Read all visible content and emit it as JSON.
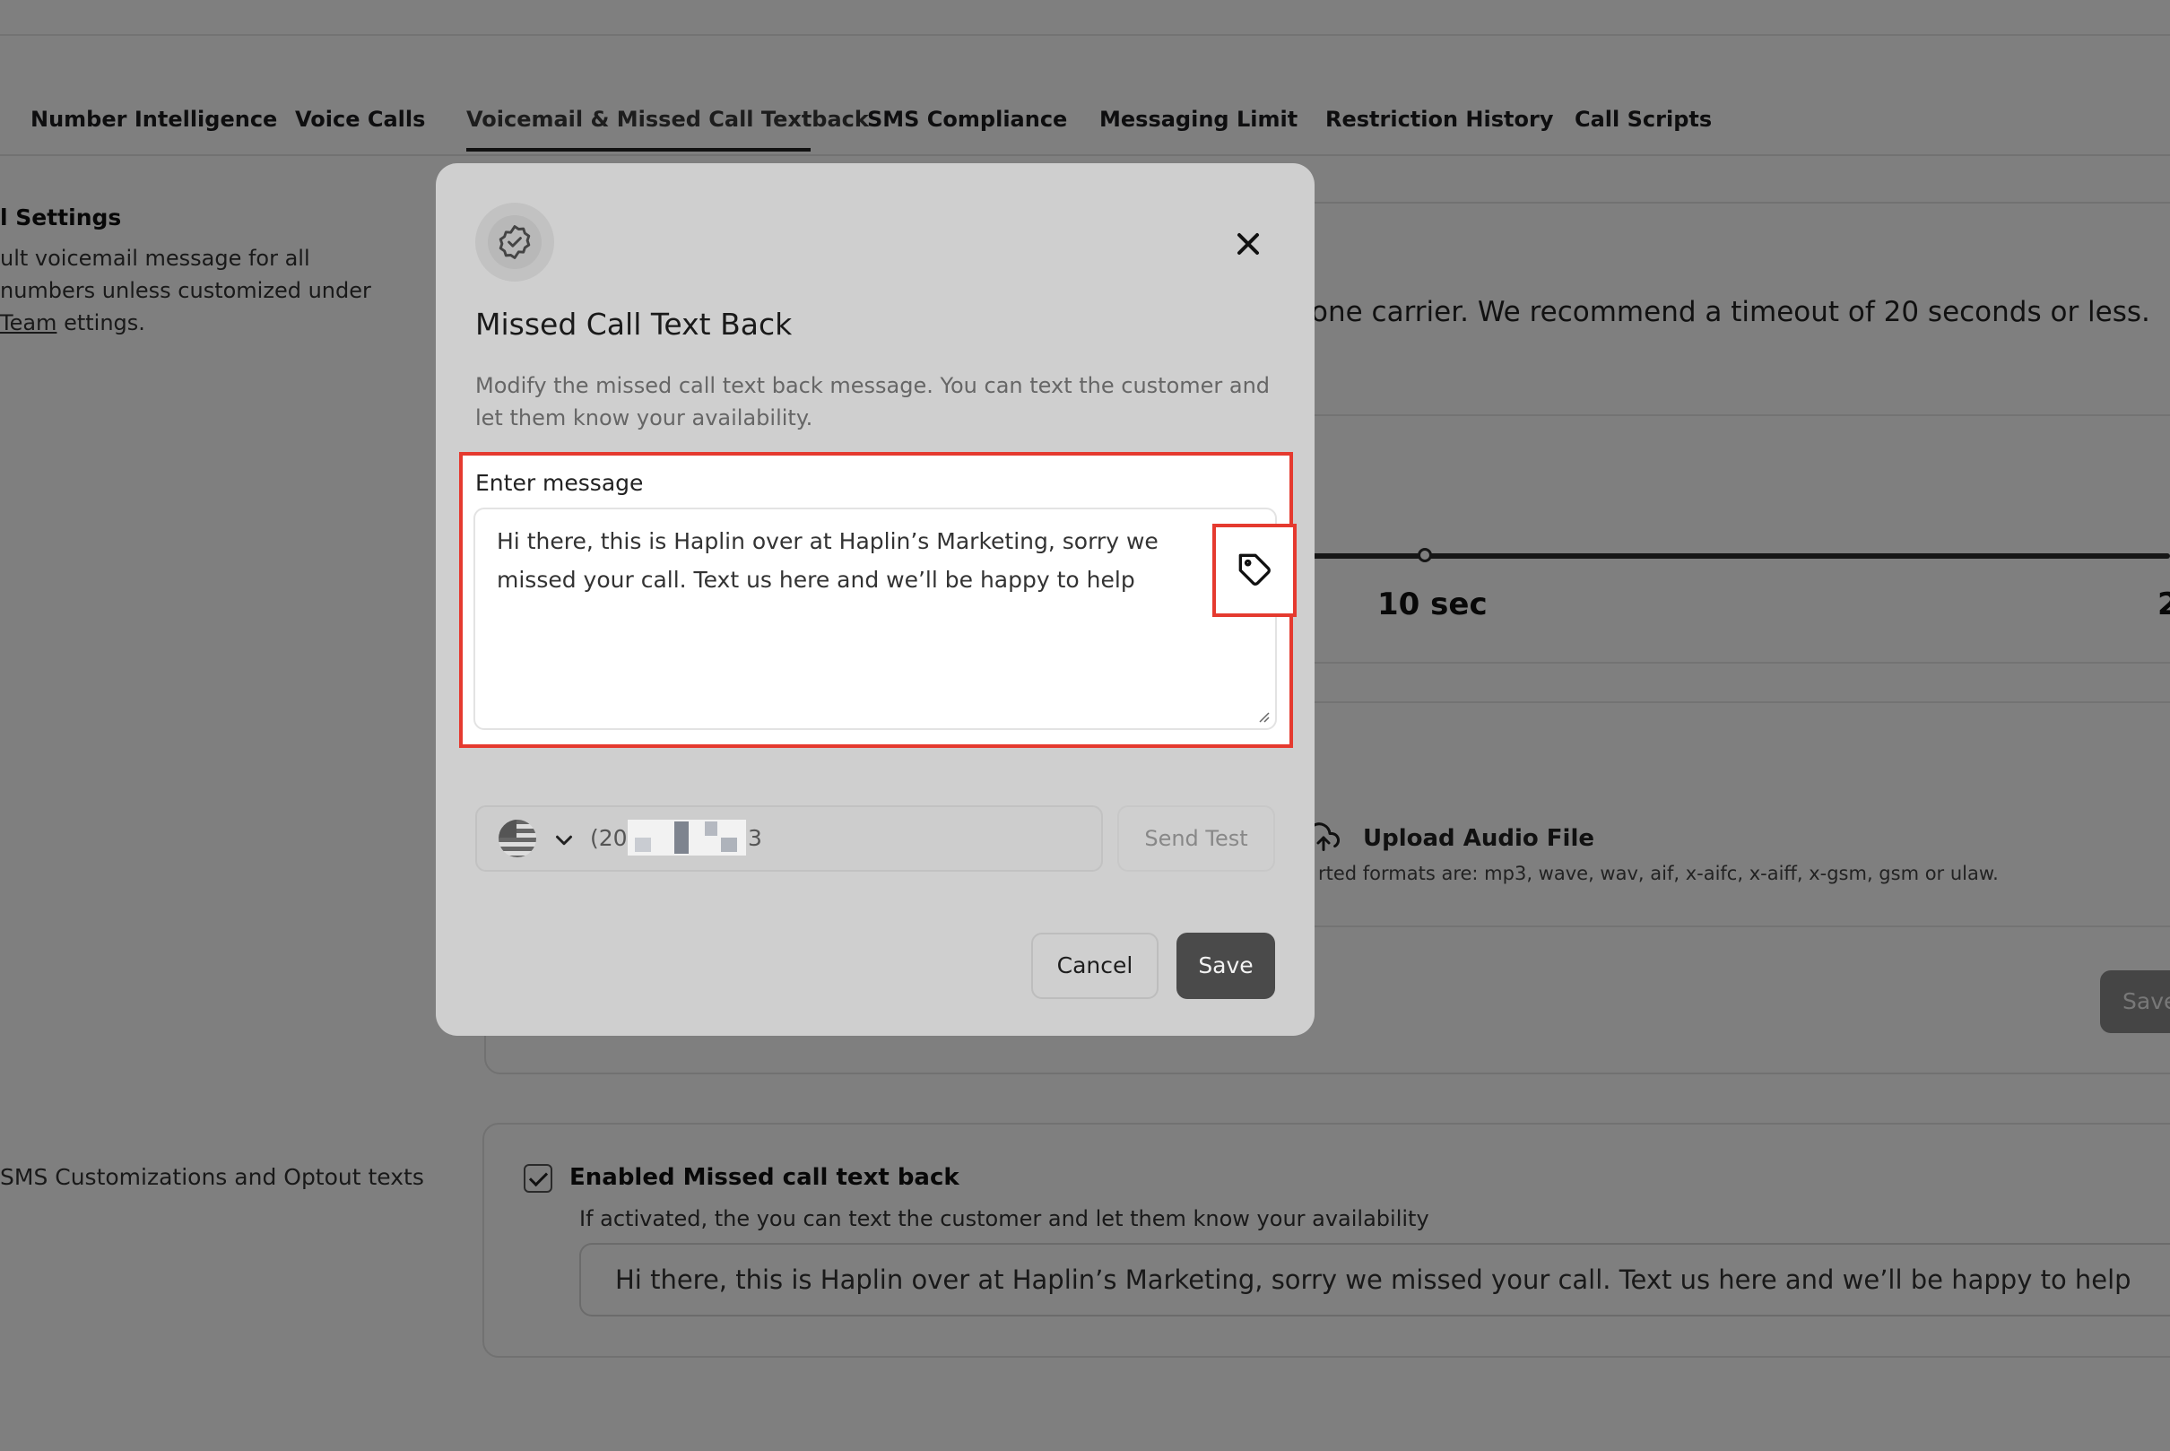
{
  "tabs": [
    {
      "label": "Number Intelligence"
    },
    {
      "label": "Voice Calls"
    },
    {
      "label": "Voicemail & Missed Call Textback"
    },
    {
      "label": "SMS Compliance"
    },
    {
      "label": "Messaging Limit"
    },
    {
      "label": "Restriction History"
    },
    {
      "label": "Call Scripts"
    }
  ],
  "left": {
    "settings_title": "l Settings",
    "settings_desc_before": "ult voicemail message for all numbers unless customized under ",
    "settings_desc_link": "Team",
    "settings_desc_after": " ettings.",
    "sms_label": "SMS Customizations and Optout texts"
  },
  "voicemail_card": {
    "carrier_text": "one carrier. We recommend a timeout of 20 seconds or less.",
    "slider_label": "10 sec",
    "slider_label_next": "2",
    "upload_title": "Upload Audio File",
    "upload_formats": "rted formats are: mp3, wave, wav, aif, x-aifc, x-aiff, x-gsm, gsm or ulaw.",
    "save_label": "Save"
  },
  "missed_call_card": {
    "checkbox_label": "Enabled Missed call text back",
    "help_text": "If activated, the you can text the customer and let them know your availability",
    "message_value": "Hi there, this is Haplin over at Haplin’s Marketing, sorry we missed your call. Text us here and we’ll be happy to help"
  },
  "modal": {
    "title": "Missed Call Text Back",
    "description": "Modify the missed call text back message. You can text the customer and let them know your availability.",
    "message_label": "Enter message",
    "message_value": "Hi there, this is Haplin over at Haplin’s Marketing, sorry we missed your call. Text us here and we’ll be happy to help",
    "phone_prefix": "(20",
    "phone_suffix": "3",
    "send_test_label": "Send Test",
    "cancel_label": "Cancel",
    "save_label": "Save"
  },
  "icons": {
    "header_icon": "badge-check-icon",
    "close": "close-icon",
    "tag": "tag-icon",
    "upload": "cloud-upload-icon",
    "flag": "us-flag-icon",
    "chevron": "chevron-down-icon"
  },
  "colors": {
    "highlight": "#e53a2f",
    "primary_button": "#4a4a4a"
  }
}
